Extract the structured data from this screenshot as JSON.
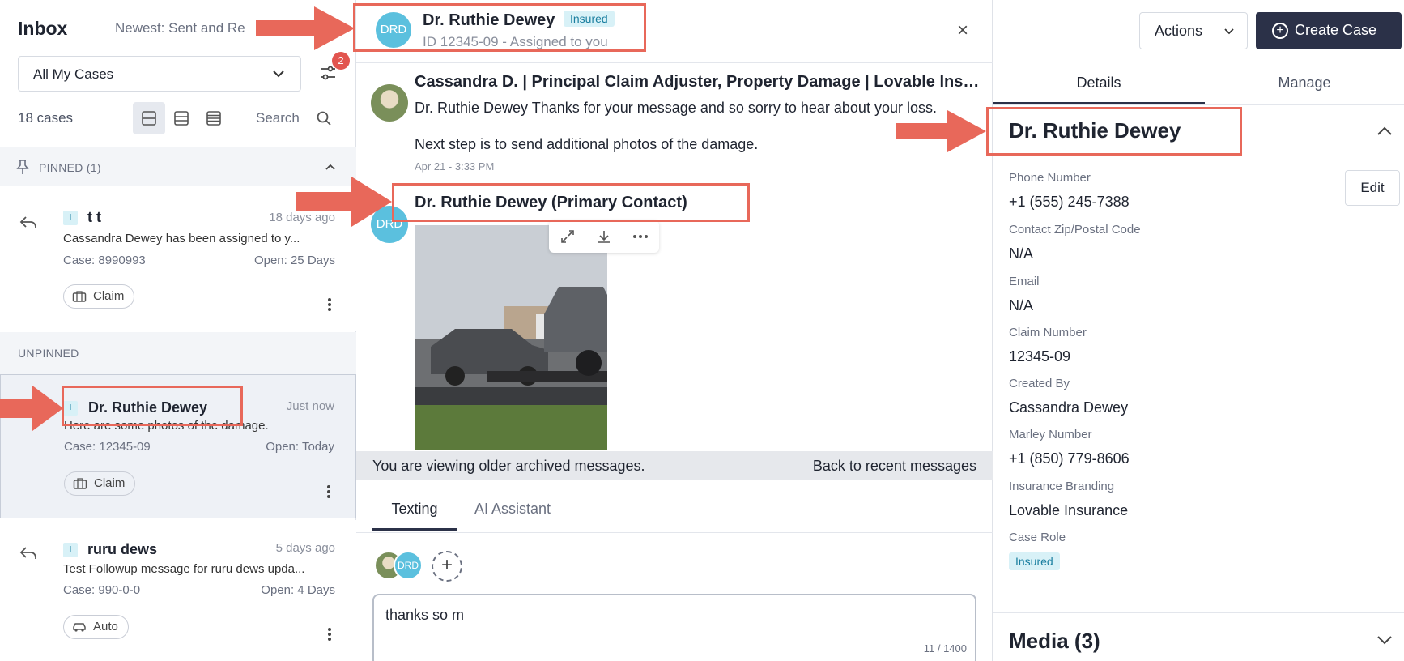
{
  "inbox": {
    "title": "Inbox",
    "sort_label": "Newest: Sent and Re",
    "filter_select": "All My Cases",
    "filter_badge": "2",
    "case_count": "18 cases",
    "search_label": "Search"
  },
  "sections": {
    "pinned": "PINNED (1)",
    "unpinned": "UNPINNED"
  },
  "cases": [
    {
      "type": "I",
      "name": "t t",
      "time": "18 days ago",
      "preview": "Cassandra Dewey has been assigned to y...",
      "case_number": "Case: 8990993",
      "open": "Open: 25 Days",
      "tag": "Claim"
    },
    {
      "type": "I",
      "name": "Dr. Ruthie Dewey",
      "time": "Just now",
      "preview": "Here are some photos of the damage.",
      "case_number": "Case: 12345-09",
      "open": "Open: Today",
      "tag": "Claim"
    },
    {
      "type": "I",
      "name": "ruru dews",
      "time": "5 days ago",
      "preview": "Test Followup message for ruru dews upda...",
      "case_number": "Case: 990-0-0",
      "open": "Open: 4 Days",
      "tag": "Auto"
    }
  ],
  "chat": {
    "avatar_initials": "DRD",
    "name": "Dr. Ruthie Dewey",
    "badge": "Insured",
    "subtitle": "ID 12345-09 - Assigned to you",
    "close": "×",
    "messages": [
      {
        "sender": "Cassandra D. | Principal Claim Adjuster, Property Damage | Lovable Insurance",
        "line1": "Dr. Ruthie Dewey Thanks for your message and so sorry to hear about your loss.",
        "line2": "Next step is to send additional photos of the damage.",
        "time": "Apr 21 - 3:33 PM"
      },
      {
        "sender": "Dr. Ruthie Dewey (Primary Contact)",
        "avatar_initials": "DRD"
      }
    ],
    "archived_notice": "You are viewing older archived messages.",
    "back_link": "Back to recent messages",
    "tabs": [
      "Texting",
      "AI Assistant"
    ],
    "participant_initials": "DRD",
    "composer_value": "thanks so m",
    "char_count": "11 / 1400"
  },
  "details": {
    "actions_label": "Actions",
    "create_label": "Create Case",
    "tabs": [
      "Details",
      "Manage"
    ],
    "contact_name": "Dr. Ruthie Dewey",
    "edit_label": "Edit",
    "fields": [
      {
        "label": "Phone Number",
        "value": "+1 (555) 245-7388"
      },
      {
        "label": "Contact Zip/Postal Code",
        "value": "N/A"
      },
      {
        "label": "Email",
        "value": "N/A"
      },
      {
        "label": "Claim Number",
        "value": "12345-09"
      },
      {
        "label": "Created By",
        "value": "Cassandra Dewey"
      },
      {
        "label": "Marley Number",
        "value": "+1 (850) 779-8606"
      },
      {
        "label": "Insurance Branding",
        "value": "Lovable Insurance"
      }
    ],
    "case_role_label": "Case Role",
    "case_role_value": "Insured",
    "media_title": "Media (3)"
  },
  "colors": {
    "accent_dark": "#2b3148",
    "badge_bg": "#d8f1f7",
    "badge_fg": "#1b7fa0",
    "annotation": "#e8685a",
    "notification": "#e2554f"
  }
}
